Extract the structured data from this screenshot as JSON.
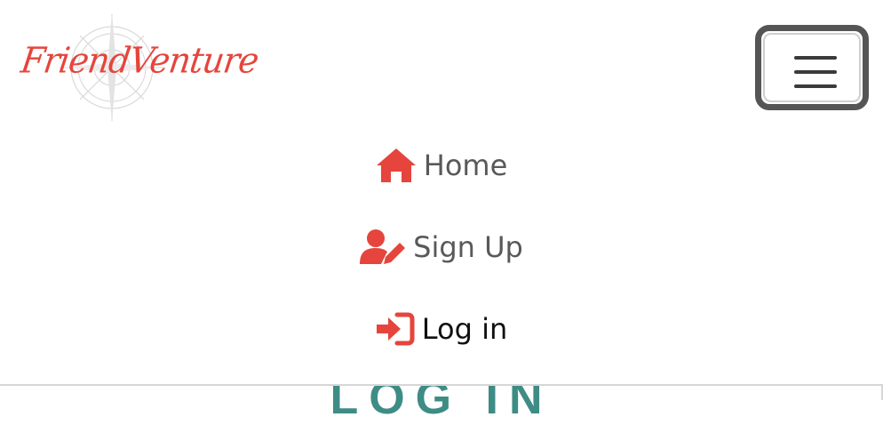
{
  "brand": {
    "name": "FriendVenture",
    "logo_icon": "compass-icon",
    "color": "#e5453c"
  },
  "navbar": {
    "toggler_icon": "hamburger-menu-icon",
    "items": [
      {
        "label": "Home",
        "icon": "house-icon",
        "active": false
      },
      {
        "label": "Sign Up",
        "icon": "user-pen-icon",
        "active": false
      },
      {
        "label": "Log in",
        "icon": "sign-in-icon",
        "active": true
      }
    ]
  },
  "page": {
    "heading": "LOG IN"
  },
  "colors": {
    "accent": "#e5453c",
    "nav_text": "#595959",
    "nav_active_text": "#111111",
    "heading": "#3e8c86",
    "toggler_border": "#555555"
  }
}
